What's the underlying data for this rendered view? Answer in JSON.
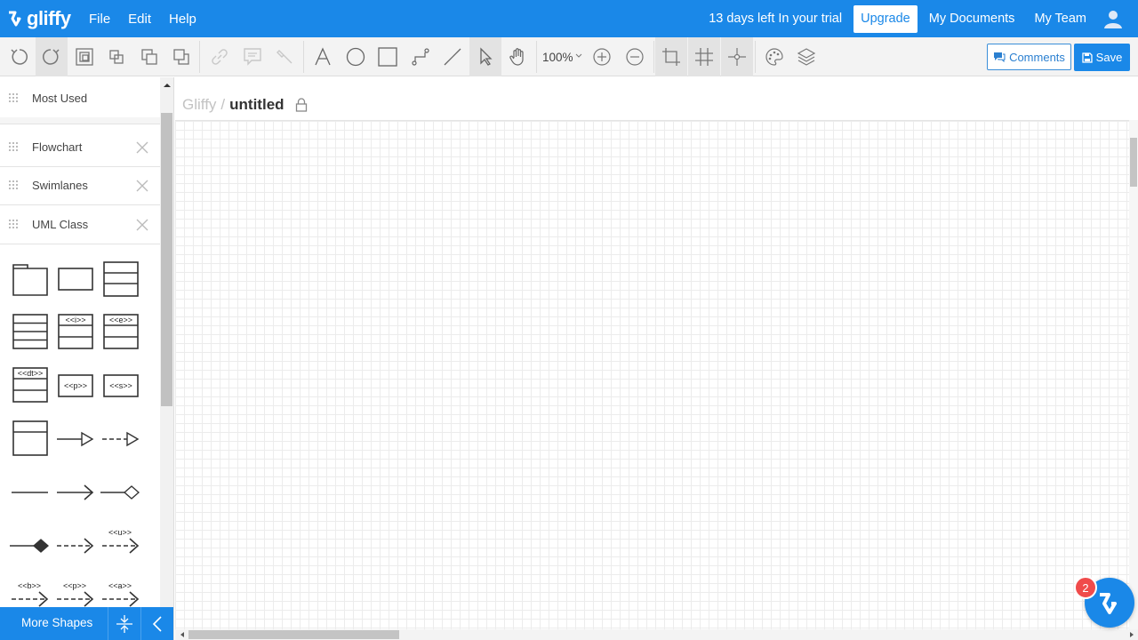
{
  "app": {
    "logo_text": "gliffy"
  },
  "menu": {
    "file": "File",
    "edit": "Edit",
    "help": "Help"
  },
  "header": {
    "trial_text": "13 days left In your trial",
    "upgrade_label": "Upgrade",
    "my_documents": "My Documents",
    "my_team": "My Team"
  },
  "toolbar": {
    "zoom_label": "100%",
    "comments_label": "Comments",
    "save_label": "Save"
  },
  "sidebar": {
    "most_used": "Most Used",
    "libraries": [
      {
        "label": "Flowchart"
      },
      {
        "label": "Swimlanes"
      },
      {
        "label": "UML Class"
      }
    ],
    "stereotypes": {
      "i": "<<i>>",
      "e": "<<e>>",
      "dt": "<<dt>>",
      "p": "<<p>>",
      "s": "<<s>>",
      "u": "<<u>>",
      "b": "<<b>>",
      "a": "<<a>>"
    },
    "more_shapes_label": "More Shapes"
  },
  "document": {
    "breadcrumb_root": "Gliffy",
    "separator": "/",
    "title": "untitled"
  },
  "notifications": {
    "badge_count": "2"
  },
  "colors": {
    "brand_blue": "#1a88e8",
    "badge_red": "#f04b4b"
  }
}
